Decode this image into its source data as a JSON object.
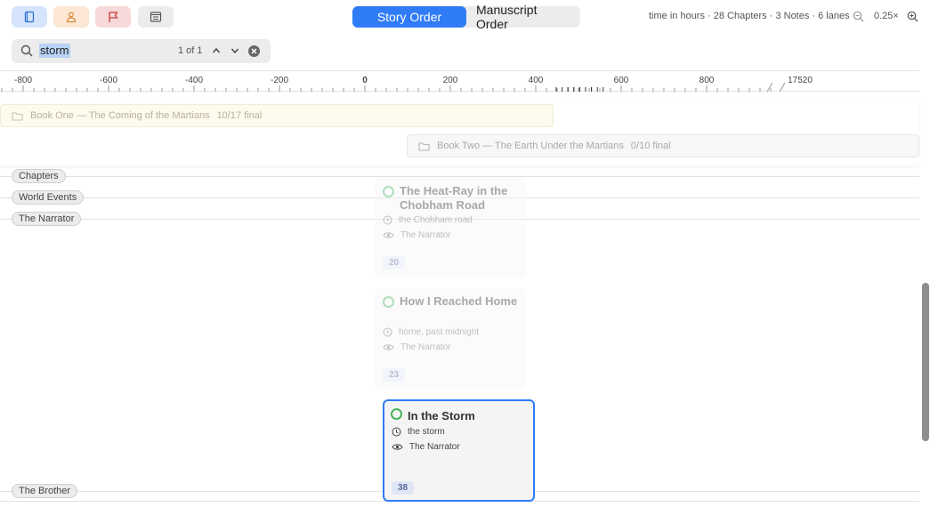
{
  "toolbar": {
    "buttons": [
      {
        "name": "book-icon",
        "bg": "#d6e4fb",
        "color": "#2f6fd6"
      },
      {
        "name": "person-icon",
        "bg": "#fbe7d3",
        "color": "#d98b3a"
      },
      {
        "name": "flag-icon",
        "bg": "#f8d9d9",
        "color": "#c43b3b"
      },
      {
        "name": "notes-icon",
        "bg": "#ececec",
        "color": "#555555"
      }
    ],
    "view_toggle": {
      "story_order": "Story Order",
      "manuscript_order": "Manuscript Order",
      "active": "Story Order"
    },
    "info": "time in hours · 28 Chapters · 3 Notes · 6 lanes",
    "zoom_level": "0.25×"
  },
  "search": {
    "value": "storm",
    "placeholder": "",
    "match_count": "1 of 1"
  },
  "ruler": {
    "labels": [
      "-800",
      "-600",
      "-400",
      "-200",
      "0",
      "200",
      "400",
      "600",
      "800",
      "17520"
    ]
  },
  "books": [
    {
      "title": "Book One — The Coming of the Martians",
      "progress": "10/17 final"
    },
    {
      "title": "Book Two — The Earth Under the Martians",
      "progress": "0/10 final"
    }
  ],
  "lanes": [
    "Chapters",
    "World Events",
    "The Narrator",
    "The Brother"
  ],
  "cards": [
    {
      "title": "The Heat-Ray in the Chobham Road",
      "time": "the Chobham road",
      "pov": "The Narrator",
      "number": "20"
    },
    {
      "title": "How I Reached Home",
      "time": "home, past midnight",
      "pov": "The Narrator",
      "number": "23"
    },
    {
      "title": "In the Storm",
      "time": "the storm",
      "pov": "The Narrator",
      "number": "38"
    }
  ],
  "colors": {
    "accent": "#2f7cf6",
    "status_green": "#48b35c"
  }
}
